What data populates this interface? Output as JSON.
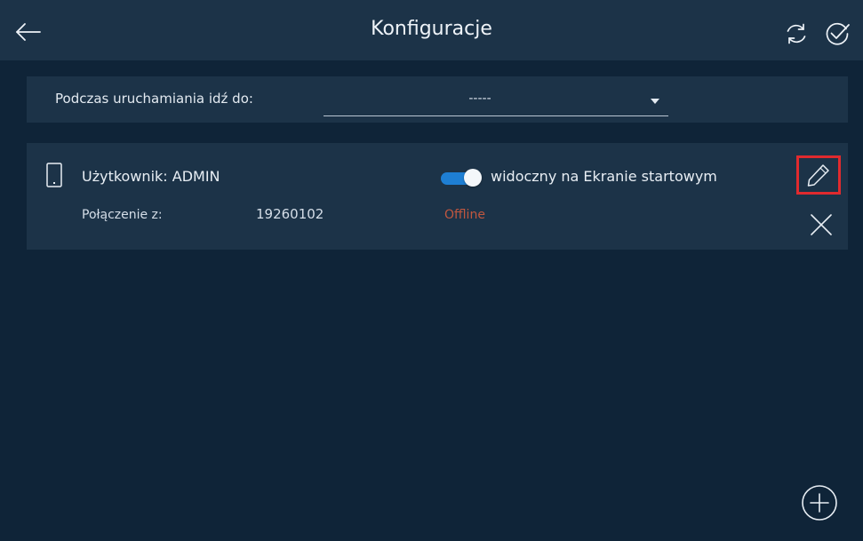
{
  "header": {
    "title": "Konfiguracje",
    "back_icon": "arrow-left-icon",
    "refresh_icon": "refresh-icon",
    "confirm_icon": "check-circle-icon"
  },
  "startup": {
    "label": "Podczas uruchamiania  idź do:",
    "selected_value": "-----",
    "dropdown_icon": "caret-down-icon"
  },
  "device": {
    "device_icon": "phone-icon",
    "user_label": "Użytkownik: ADMIN",
    "connection_label": "Połączenie z:",
    "connection_value": "19260102",
    "status": "Offline",
    "visible_toggle_on": true,
    "visible_label": "widoczny na Ekranie startowym",
    "edit_icon": "pencil-icon",
    "delete_icon": "close-icon"
  },
  "footer": {
    "add_icon": "plus-circle-icon"
  },
  "colors": {
    "background": "#0f2438",
    "panel": "#1c3348",
    "accent_toggle": "#1e7fd4",
    "status_offline": "#c0573f",
    "highlight_border": "#e02a2e"
  }
}
